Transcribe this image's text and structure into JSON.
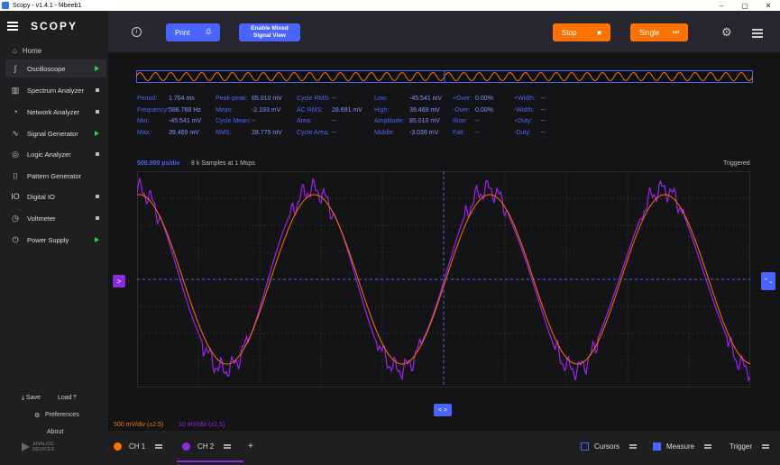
{
  "window": {
    "title": "Scopy - v1.4.1 - f4beeb1",
    "min": "–",
    "max": "▢",
    "close": "✕"
  },
  "sidebar": {
    "logo": "SCOPY",
    "home": "Home",
    "items": [
      {
        "label": "Oscilloscope",
        "icon": "oscilloscope-icon",
        "glyph": "∫",
        "indicator": "play",
        "active": true
      },
      {
        "label": "Spectrum Analyzer",
        "icon": "spectrum-icon",
        "glyph": "▥",
        "indicator": "stop"
      },
      {
        "label": "Network Analyzer",
        "icon": "network-icon",
        "glyph": "◔",
        "indicator": "stop"
      },
      {
        "label": "Signal Generator",
        "icon": "signal-generator-icon",
        "glyph": "∿",
        "indicator": "play"
      },
      {
        "label": "Logic Analyzer",
        "icon": "logic-analyzer-icon",
        "glyph": "◎",
        "indicator": "stop"
      },
      {
        "label": "Pattern Generator",
        "icon": "pattern-generator-icon",
        "glyph": "⌷",
        "indicator": "none"
      },
      {
        "label": "Digital IO",
        "icon": "digital-io-icon",
        "glyph": "IO",
        "indicator": "stop"
      },
      {
        "label": "Voltmeter",
        "icon": "voltmeter-icon",
        "glyph": "◷",
        "indicator": "stop"
      },
      {
        "label": "Power Supply",
        "icon": "power-supply-icon",
        "glyph": "⏻",
        "indicator": "play"
      }
    ],
    "save": "Save",
    "load": "Load",
    "preferences": "Preferences",
    "about": "About",
    "brand_line1": "ANALOG",
    "brand_line2": "DEVICES"
  },
  "toolbar": {
    "print": "Print",
    "mixed_line1": "Enable Mixed",
    "mixed_line2": "Signal View",
    "stop": "Stop",
    "single": "Single"
  },
  "measurements": [
    [
      [
        "Period:",
        "1.704 ms"
      ],
      [
        "Peak-peak:",
        "85.010 mV"
      ],
      [
        "Cycle RMS:",
        "--"
      ],
      [
        "Low:",
        "-45.541 mV"
      ],
      [
        "+Over:",
        "0.00%"
      ],
      [
        "+Width:",
        "--"
      ]
    ],
    [
      [
        "Frequency:",
        "586.768 Hz"
      ],
      [
        "Mean:",
        "-2.193 mV"
      ],
      [
        "AC RMS:",
        "28.691 mV"
      ],
      [
        "High:",
        "39.469 mV"
      ],
      [
        "-Over:",
        "0.00%"
      ],
      [
        "-Width:",
        "--"
      ]
    ],
    [
      [
        "Min:",
        "-45.541 mV"
      ],
      [
        "Cycle Mean:",
        "--"
      ],
      [
        "Area:",
        "--"
      ],
      [
        "Amplitude:",
        "85.010 mV"
      ],
      [
        "Rise:",
        "--"
      ],
      [
        "+Duty:",
        "--"
      ]
    ],
    [
      [
        "Max:",
        "39.469 mV"
      ],
      [
        "RMS:",
        "28.775 mV"
      ],
      [
        "Cycle Area:",
        "--"
      ],
      [
        "Middle:",
        "-3.036 mV"
      ],
      [
        "Fall:",
        "--"
      ],
      [
        "-Duty:",
        "--"
      ]
    ]
  ],
  "plot": {
    "timebase": "500.000 µs/div",
    "samples": "8 k Samples at 1 Msps",
    "status": "Triggered",
    "ch1_scale": "500 mV/div (±2.5)",
    "ch2_scale": "10 mV/div (±2.5)",
    "ch1_color": "#ff7200",
    "ch2_color": "#a020f0",
    "ch2_marker": ">",
    "right_marker": "⌃⌄",
    "time_marker": "< >"
  },
  "bottombar": {
    "ch1": "CH 1",
    "ch2": "CH 2",
    "add": "+",
    "cursors": "Cursors",
    "measure": "Measure",
    "trigger": "Trigger"
  }
}
